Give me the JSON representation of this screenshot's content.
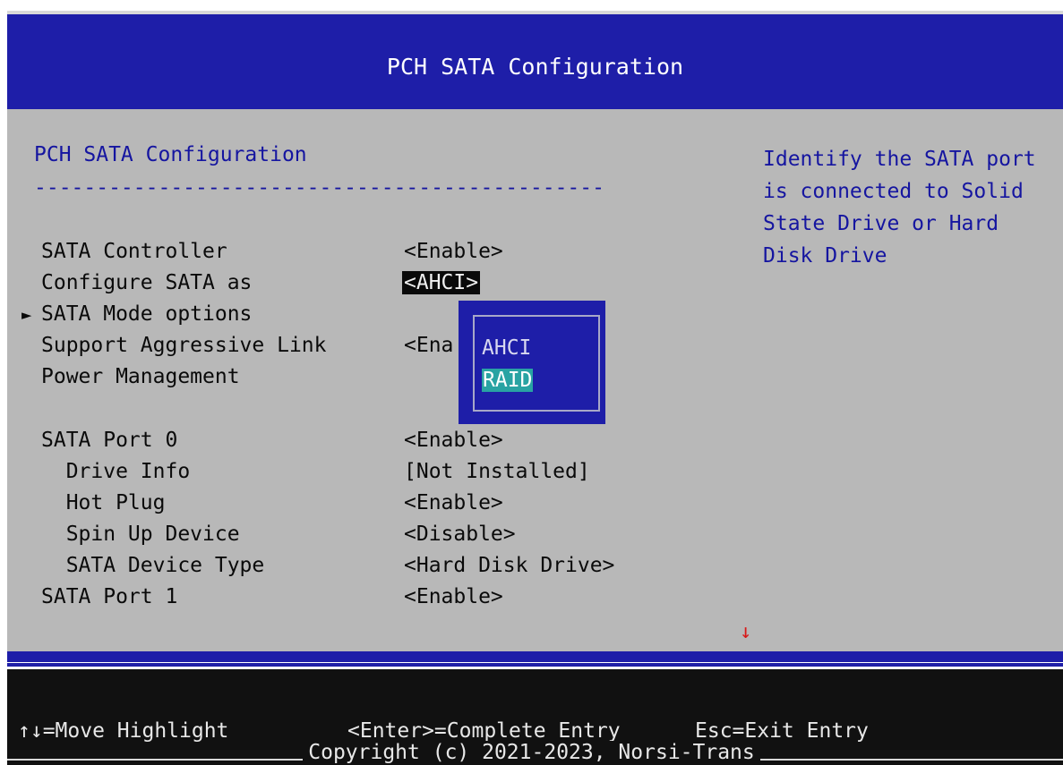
{
  "header": {
    "title": "PCH SATA Configuration"
  },
  "main": {
    "section_title": "PCH SATA Configuration",
    "divider": "----------------------------------------------",
    "items": [
      {
        "label": "SATA Controller",
        "value": "<Enable>"
      },
      {
        "label": "Configure SATA as",
        "value": "<AHCI>"
      },
      {
        "label": "SATA Mode options",
        "value": ""
      },
      {
        "label": "Support Aggressive Link",
        "value": "<Ena"
      },
      {
        "label": "Power Management",
        "value": ""
      },
      {
        "label": "SATA Port 0",
        "value": "<Enable>"
      },
      {
        "label": "  Drive Info",
        "value": "[Not Installed]"
      },
      {
        "label": "  Hot Plug",
        "value": "<Enable>"
      },
      {
        "label": "  Spin Up Device",
        "value": "<Disable>"
      },
      {
        "label": "  SATA Device Type",
        "value": "<Hard Disk Drive>"
      },
      {
        "label": "SATA Port 1",
        "value": "<Enable>"
      }
    ],
    "submenu_arrow": "►",
    "scroll_indicator": "↓"
  },
  "help": {
    "text": "Identify the SATA port is connected to Solid State Drive or Hard Disk Drive"
  },
  "popup": {
    "options": [
      "AHCI",
      "RAID"
    ],
    "selected": "RAID"
  },
  "footer": {
    "move_hint": "↑↓=Move Highlight",
    "enter_hint": "<Enter>=Complete Entry",
    "esc_hint": "Esc=Exit Entry",
    "copyright": "Copyright (c) 2021-2023, Norsi-Trans"
  },
  "colors": {
    "header_bg": "#1e1ea8",
    "body_bg": "#b8b8b8",
    "accent_text": "#1515a0",
    "selection": "#29a3a3",
    "footer_bg": "#111111"
  }
}
